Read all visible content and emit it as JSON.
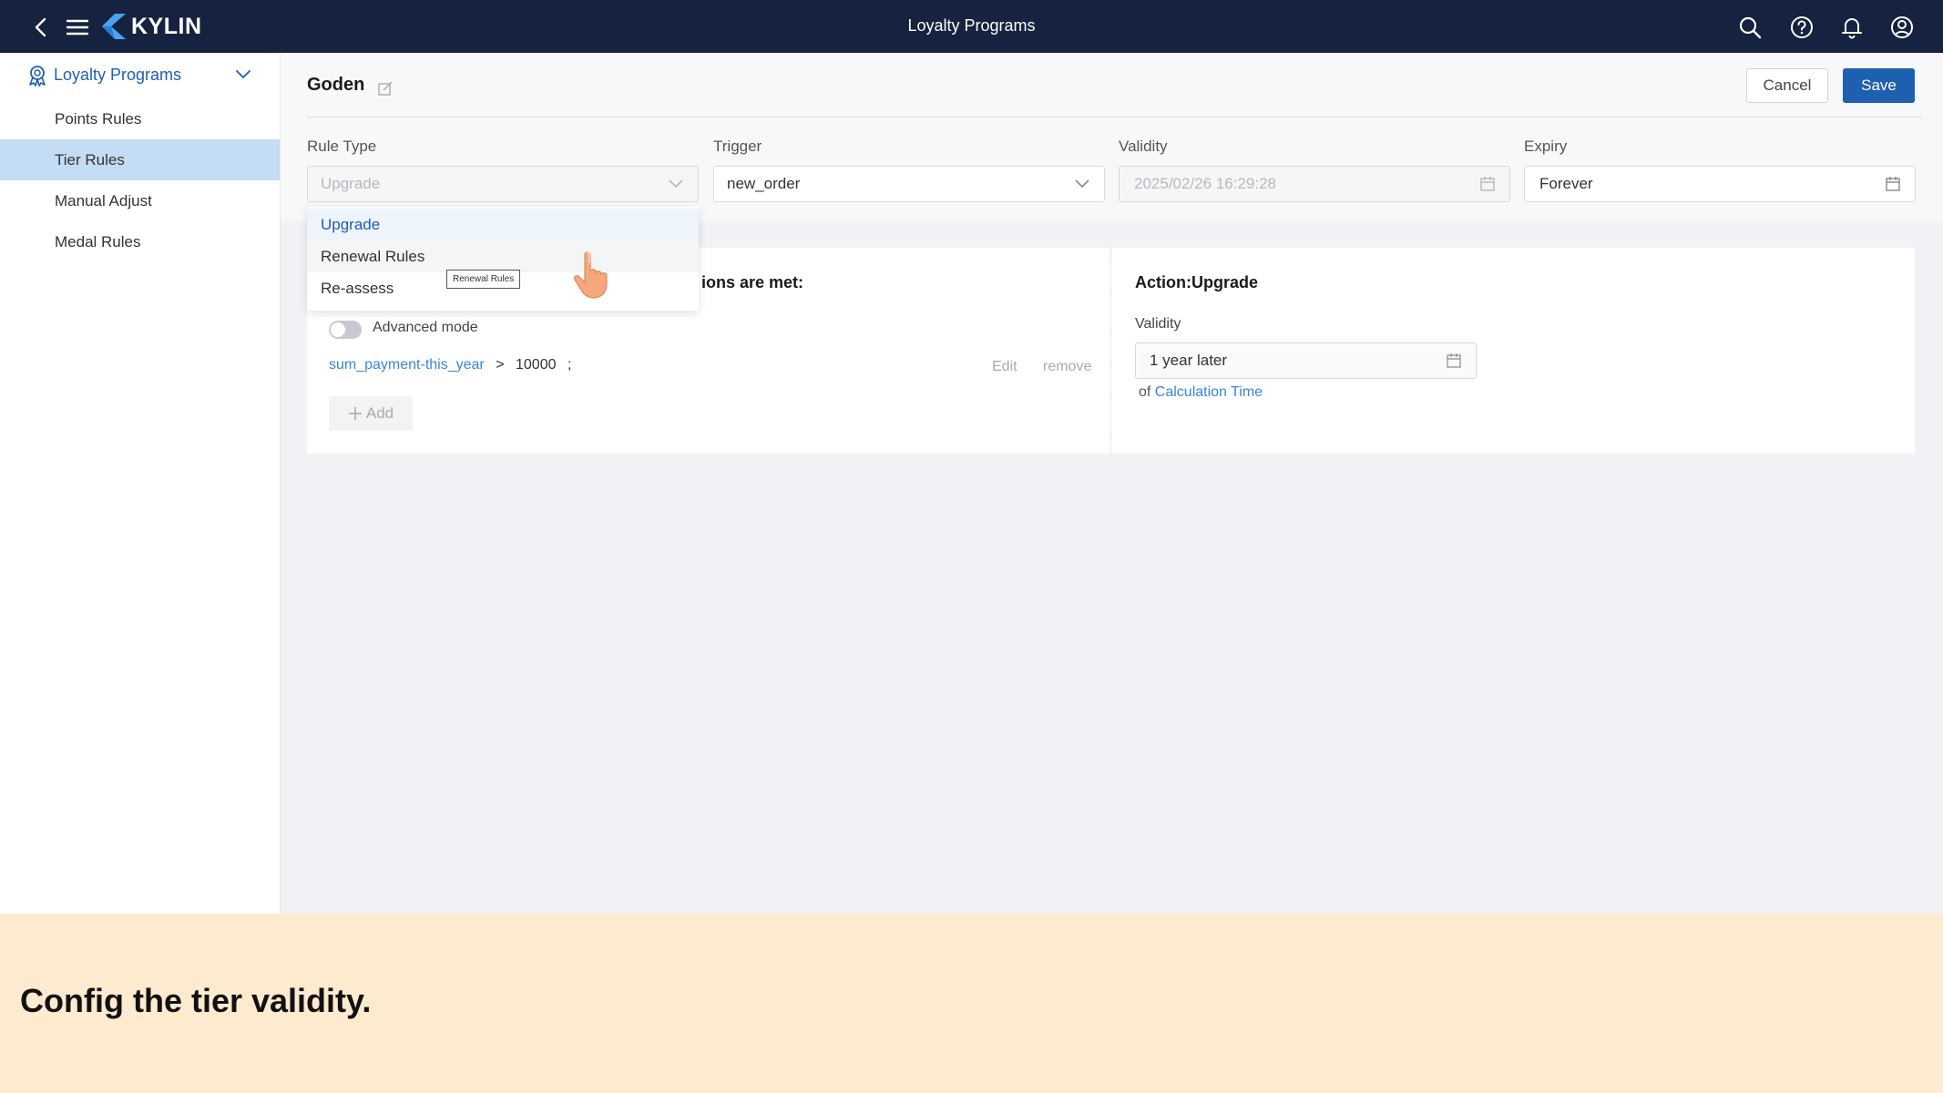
{
  "app": {
    "brand": "KYLIN",
    "window_title": "Loyalty Programs",
    "icons": [
      "back-arrow-icon",
      "menu-icon",
      "kylin-logo-icon",
      "search-icon",
      "help-icon",
      "bell-icon",
      "user-circle-icon"
    ]
  },
  "sidebar": {
    "group": {
      "label": "Loyalty Programs",
      "icon": "ribbon-icon",
      "expanded": true
    },
    "items": [
      {
        "label": "Points Rules",
        "active": false
      },
      {
        "label": "Tier Rules",
        "active": true
      },
      {
        "label": "Manual Adjust",
        "active": false
      },
      {
        "label": "Medal Rules",
        "active": false
      }
    ]
  },
  "header": {
    "rule_name": "Goden",
    "edit_icon": "edit-icon",
    "cancel_label": "Cancel",
    "save_label": "Save"
  },
  "form": {
    "rule_type": {
      "label": "Rule Type",
      "value": "Upgrade",
      "options": [
        "Upgrade",
        "Renewal Rules",
        "Re-assess"
      ],
      "selected": "Upgrade",
      "hovered": "Renewal Rules"
    },
    "trigger": {
      "label": "Trigger",
      "value": "new_order"
    },
    "validity": {
      "label": "Validity",
      "value": "2025/02/26 16:29:28"
    },
    "expiry": {
      "label": "Expiry",
      "value": "Forever"
    }
  },
  "tooltip": "Renewal Rules",
  "conditions": {
    "title_visible": "ions are met:",
    "advanced_mode_label": "Advanced mode",
    "advanced_mode_on": false,
    "rule": {
      "variable": "sum_payment-this_year",
      "operator": ">",
      "value": "10000",
      "terminator": ";"
    },
    "edit_label": "Edit",
    "remove_label": "remove",
    "add_label": "Add"
  },
  "action": {
    "title": "Action:Upgrade",
    "validity_label": "Validity",
    "validity_value": "1 year later",
    "of_prefix": "of",
    "of_link": "Calculation Time"
  },
  "caption": "Config the tier validity.",
  "colors": {
    "topbar": "#152240",
    "accent": "#1e5fb0",
    "link": "#3a86d6",
    "active_nav": "#c5dcf5",
    "caption_band": "#fdeacf"
  }
}
